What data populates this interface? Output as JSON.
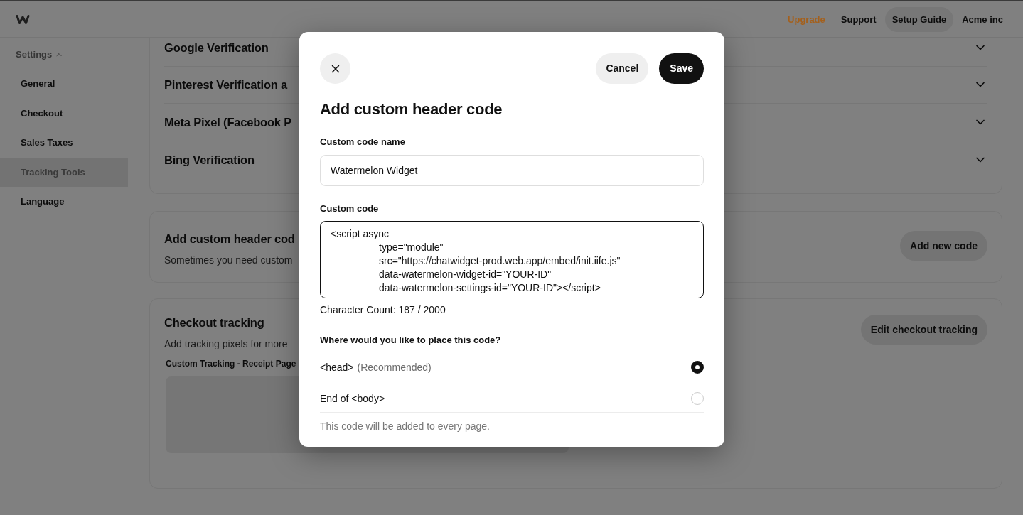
{
  "top_bar": {
    "nav": [
      {
        "label": "Upgrade",
        "kind": "upgrade"
      },
      {
        "label": "Support",
        "kind": "link"
      },
      {
        "label": "Setup Guide",
        "kind": "pill"
      },
      {
        "label": "Acme inc",
        "kind": "link"
      }
    ]
  },
  "sidebar": {
    "section": {
      "label": "Settings",
      "expanded": true
    },
    "items": [
      {
        "label": "General",
        "selected": false
      },
      {
        "label": "Checkout",
        "selected": false
      },
      {
        "label": "Sales Taxes",
        "selected": false
      },
      {
        "label": "Tracking Tools",
        "selected": true
      },
      {
        "label": "Language",
        "selected": false
      }
    ]
  },
  "verification_sections": [
    {
      "title": "Google Verification",
      "expanded": false
    },
    {
      "title": "Pinterest Verification a",
      "expanded": false
    },
    {
      "title": "Meta Pixel (Facebook P",
      "expanded": false
    },
    {
      "title": "Bing Verification",
      "expanded": false
    }
  ],
  "custom_header_code": {
    "title": "Add custom header cod",
    "description": "Sometimes you need custom",
    "button": "Add new code"
  },
  "checkout_tracking": {
    "title": "Checkout tracking",
    "description": "Add tracking pixels for more",
    "field_label": "Custom Tracking - Receipt Page",
    "button": "Edit checkout tracking"
  },
  "modal": {
    "title": "Add custom header code",
    "buttons": [
      {
        "label": "Cancel",
        "kind": "secondary"
      },
      {
        "label": "Save",
        "kind": "primary"
      }
    ],
    "name_field": {
      "label": "Custom code name",
      "value": "Watermelon Widget"
    },
    "code_field": {
      "label": "Custom code",
      "value": "<script async\n\ttype=\"module\"\n\tsrc=\"https://chatwidget-prod.web.app/embed/init.iife.js\"\n\tdata-watermelon-widget-id=\"YOUR-ID\"\n\tdata-watermelon-settings-id=\"YOUR-ID\"></script>"
    },
    "character_count": "Character Count: 187 / 2000",
    "placement": {
      "question": "Where would you like to place this code?",
      "options": [
        {
          "label": "<head>",
          "note": "(Recommended)",
          "selected": true
        },
        {
          "label": "End of <body>",
          "selected": false
        }
      ],
      "hint": "This code will be added to every page."
    }
  }
}
